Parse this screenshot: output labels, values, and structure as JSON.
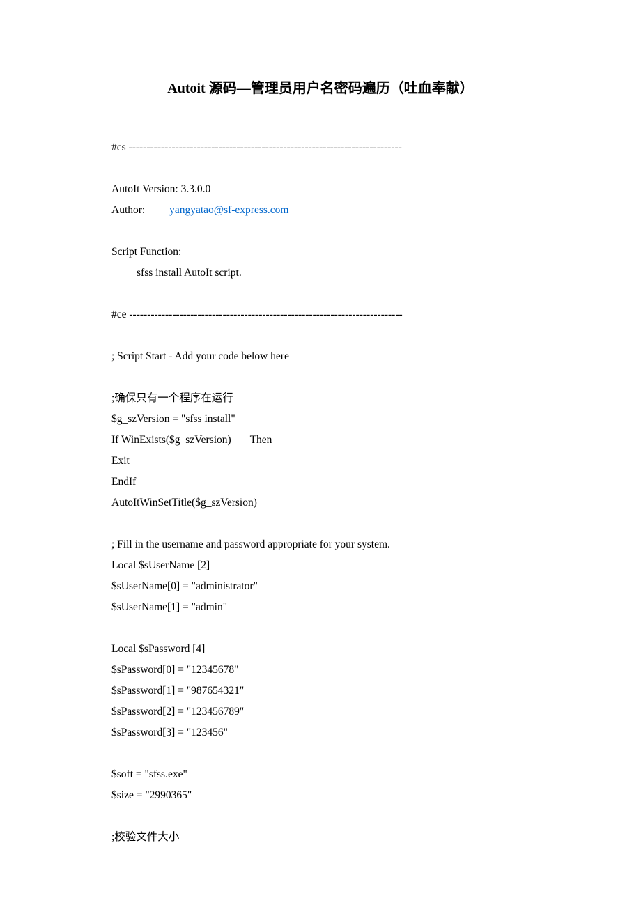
{
  "title": "Autoit 源码—管理员用户名密码遍历（吐血奉献）",
  "l1": "#cs ----------------------------------------------------------------------------",
  "l2": "AutoIt Version: 3.3.0.0",
  "l3a": "Author:         ",
  "l3b": "yangyatao@sf-express.com",
  "l4": "Script Function:",
  "l5": "sfss install AutoIt script.",
  "l6": "#ce ----------------------------------------------------------------------------",
  "l7": "; Script Start - Add your code below here",
  "l8": ";确保只有一个程序在运行",
  "l9": "$g_szVersion = \"sfss install\"",
  "l10": "If WinExists($g_szVersion)       Then",
  "l11": "Exit",
  "l12": "EndIf",
  "l13": "AutoItWinSetTitle($g_szVersion)",
  "l14": "; Fill in the username and password appropriate for your system.",
  "l15": "Local $sUserName [2]",
  "l16": "$sUserName[0] = \"administrator\"",
  "l17": "$sUserName[1] = \"admin\"",
  "l18": "Local $sPassword [4]",
  "l19": "$sPassword[0] = \"12345678\"",
  "l20": "$sPassword[1] = \"987654321\"",
  "l21": "$sPassword[2] = \"123456789\"",
  "l22": "$sPassword[3] = \"123456\"",
  "l23": "$soft = \"sfss.exe\"",
  "l24": "$size = \"2990365\"",
  "l25": ";校验文件大小"
}
